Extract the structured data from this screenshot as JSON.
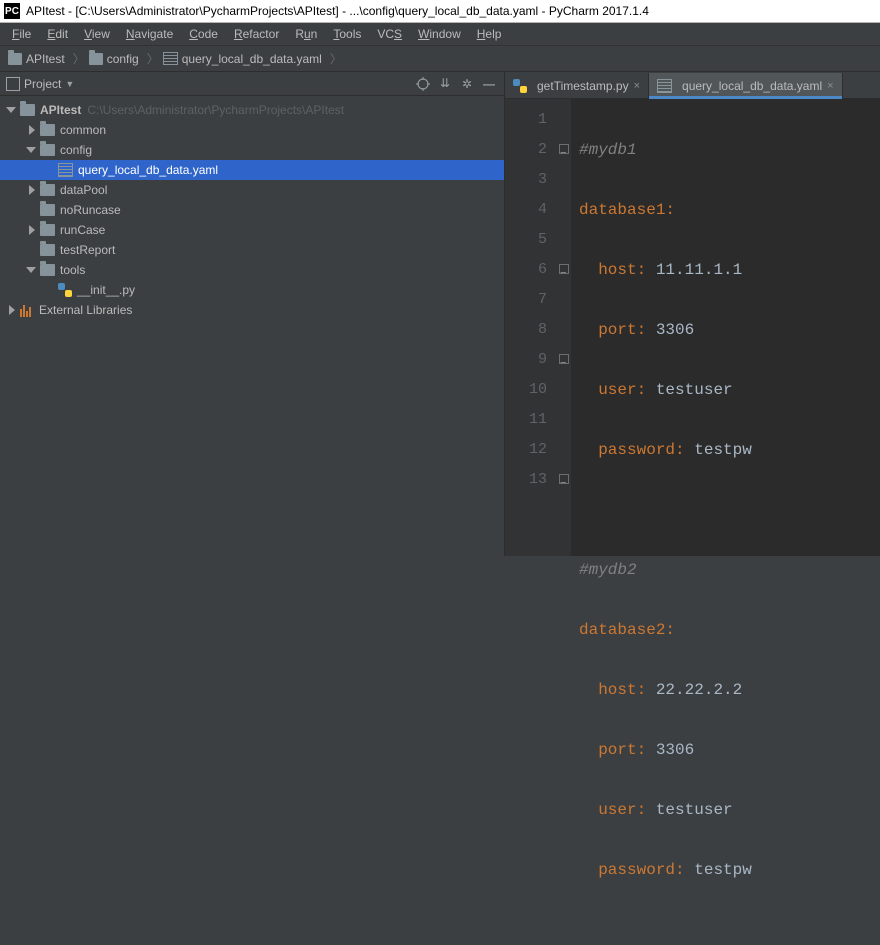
{
  "window": {
    "title": "APItest - [C:\\Users\\Administrator\\PycharmProjects\\APItest] - ...\\config\\query_local_db_data.yaml - PyCharm 2017.1.4"
  },
  "menu": {
    "items": [
      "File",
      "Edit",
      "View",
      "Navigate",
      "Code",
      "Refactor",
      "Run",
      "Tools",
      "VCS",
      "Window",
      "Help"
    ]
  },
  "breadcrumb": {
    "root": "APItest",
    "folder": "config",
    "file": "query_local_db_data.yaml"
  },
  "project_tool": {
    "title": "Project"
  },
  "tree": {
    "root": {
      "name": "APItest",
      "path": "C:\\Users\\Administrator\\PycharmProjects\\APItest"
    },
    "common": "common",
    "config": "config",
    "config_file": "query_local_db_data.yaml",
    "dataPool": "dataPool",
    "noRuncase": "noRuncase",
    "runCase": "runCase",
    "testReport": "testReport",
    "tools": "tools",
    "tools_init": "__init__.py",
    "ext_lib": "External Libraries"
  },
  "tabs": {
    "t1": "getTimestamp.py",
    "t2": "query_local_db_data.yaml"
  },
  "code": {
    "l1_comment": "#mydb1",
    "l2_key": "database1",
    "l3_key": "host",
    "l3_val": "11.11.1.1",
    "l4_key": "port",
    "l4_val": "3306",
    "l5_key": "user",
    "l5_val": "testuser",
    "l6_key": "password",
    "l6_val": "testpw",
    "l8_comment": "#mydb2",
    "l9_key": "database2",
    "l10_key": "host",
    "l10_val": "22.22.2.2",
    "l11_key": "port",
    "l11_val": "3306",
    "l12_key": "user",
    "l12_val": "testuser",
    "l13_key": "password",
    "l13_val": "testpw"
  },
  "gutter": {
    "lines": [
      "1",
      "2",
      "3",
      "4",
      "5",
      "6",
      "7",
      "8",
      "9",
      "10",
      "11",
      "12",
      "13"
    ]
  }
}
